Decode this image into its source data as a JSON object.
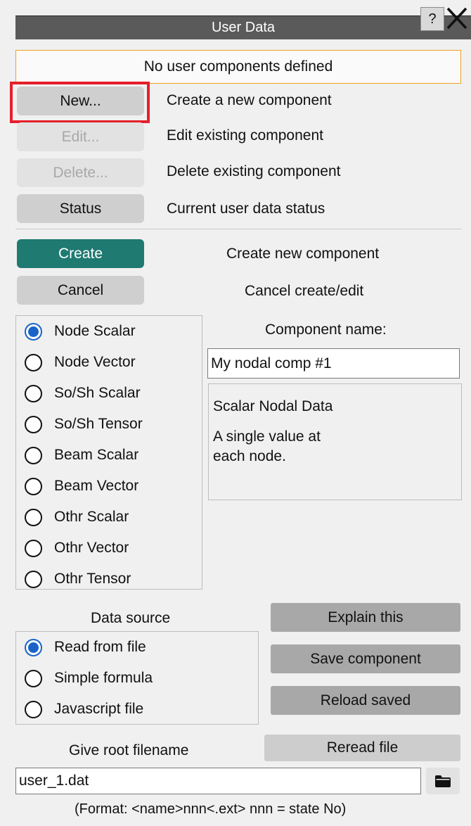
{
  "window": {
    "title": "User Data",
    "help_label": "?"
  },
  "status_banner": "No user components defined",
  "actions": [
    {
      "label": "New...",
      "description": "Create a new component",
      "enabled": true
    },
    {
      "label": "Edit...",
      "description": "Edit existing component",
      "enabled": false
    },
    {
      "label": "Delete...",
      "description": "Delete existing component",
      "enabled": false
    },
    {
      "label": "Status",
      "description": "Current user data status",
      "enabled": true
    }
  ],
  "create": {
    "label": "Create",
    "description": "Create new component"
  },
  "cancel": {
    "label": "Cancel",
    "description": "Cancel create/edit"
  },
  "component_types": [
    {
      "label": "Node Scalar",
      "checked": true
    },
    {
      "label": "Node Vector",
      "checked": false
    },
    {
      "label": "So/Sh Scalar",
      "checked": false
    },
    {
      "label": "So/Sh Tensor",
      "checked": false
    },
    {
      "label": "Beam Scalar",
      "checked": false
    },
    {
      "label": "Beam Vector",
      "checked": false
    },
    {
      "label": "Othr Scalar",
      "checked": false
    },
    {
      "label": "Othr Vector",
      "checked": false
    },
    {
      "label": "Othr Tensor",
      "checked": false
    }
  ],
  "component_name": {
    "label": "Component name:",
    "value": "My nodal comp #1"
  },
  "description": {
    "title": "Scalar Nodal Data",
    "line1": "A single value at",
    "line2": "each node."
  },
  "data_source": {
    "label": "Data source",
    "options": [
      {
        "label": "Read from file",
        "checked": true
      },
      {
        "label": "Simple formula",
        "checked": false
      },
      {
        "label": "Javascript file",
        "checked": false
      }
    ]
  },
  "buttons": {
    "explain": "Explain this",
    "save": "Save component",
    "reload": "Reload saved",
    "reread": "Reread file"
  },
  "file": {
    "label": "Give root filename",
    "value": "user_1.dat",
    "format_hint": "(Format: <name>nnn<.ext>  nnn = state No)"
  },
  "colors": {
    "accent": "#1f7a72",
    "highlight": "#e5202a",
    "banner_border": "#f0a020",
    "radio_selected": "#1a64c8"
  }
}
